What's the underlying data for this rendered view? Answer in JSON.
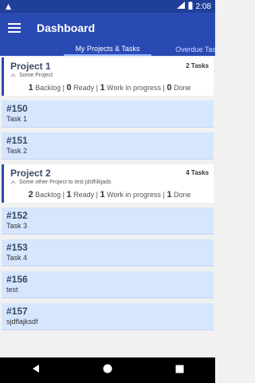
{
  "status": {
    "time": "2:08"
  },
  "app_bar": {
    "title": "Dashboard"
  },
  "tabs": [
    {
      "label": "My Projects & Tasks"
    },
    {
      "label": "Overdue Tasks"
    }
  ],
  "projects": [
    {
      "name": "Project 1",
      "count": "2 Tasks",
      "description": "Some Project",
      "stats": {
        "backlog": "1",
        "ready": "0",
        "wip": "1",
        "done": "0"
      },
      "tasks": [
        {
          "id": "#150",
          "title": "Task 1"
        },
        {
          "id": "#151",
          "title": "Task 2"
        }
      ]
    },
    {
      "name": "Project 2",
      "count": "4 Tasks",
      "description": "Some other Project to test jdsfhlkjads",
      "stats": {
        "backlog": "2",
        "ready": "1",
        "wip": "1",
        "done": "1"
      },
      "tasks": [
        {
          "id": "#152",
          "title": "Task 3"
        },
        {
          "id": "#153",
          "title": "Task 4"
        },
        {
          "id": "#156",
          "title": "test"
        },
        {
          "id": "#157",
          "title": "sjdflajksdf"
        }
      ]
    }
  ],
  "labels": {
    "backlog": "Backlog",
    "ready": "Ready",
    "wip": "Work in progress",
    "done": "Done"
  },
  "colors": {
    "primary": "#2a4ab3",
    "status_bar": "#1f3f99",
    "task_bg": "#d7e6ff"
  }
}
